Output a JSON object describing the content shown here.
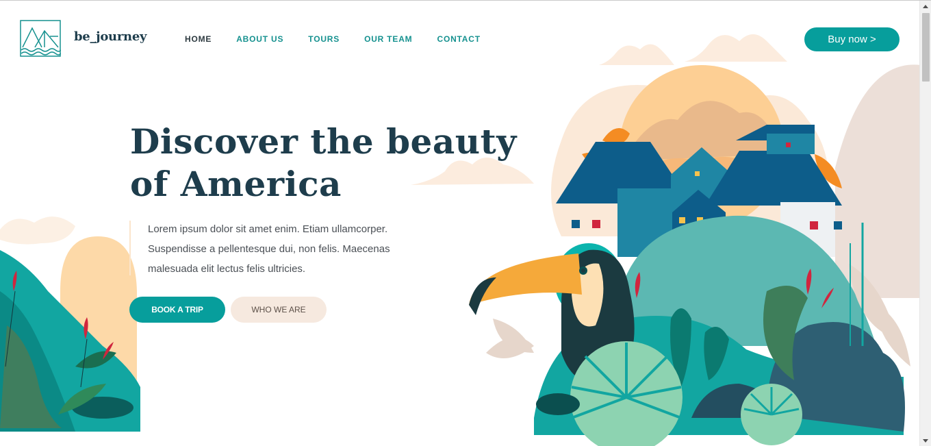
{
  "brand": {
    "name": "be_journey",
    "logo_icon": "mountain-waves-logo-icon"
  },
  "nav": {
    "items": [
      {
        "label": "HOME",
        "active": true
      },
      {
        "label": "ABOUT US",
        "active": false
      },
      {
        "label": "TOURS",
        "active": false
      },
      {
        "label": "OUR TEAM",
        "active": false
      },
      {
        "label": "CONTACT",
        "active": false
      }
    ]
  },
  "header": {
    "buy_label": "Buy now >"
  },
  "hero": {
    "title_line1": "Discover the beauty",
    "title_line2": "of America",
    "description_line1": "Lorem ipsum dolor sit amet enim. Etiam ullamcorper.",
    "description_line2": "Suspendisse a pellentesque dui, non felis. Maecenas",
    "description_line3": "malesuada elit lectus felis ultricies.",
    "primary_button": "BOOK A TRIP",
    "secondary_button": "WHO WE ARE"
  },
  "colors": {
    "accent": "#079e9c",
    "title": "#1e3d4c",
    "nav": "#15918f",
    "secondary_button_bg": "#f6e9df"
  }
}
